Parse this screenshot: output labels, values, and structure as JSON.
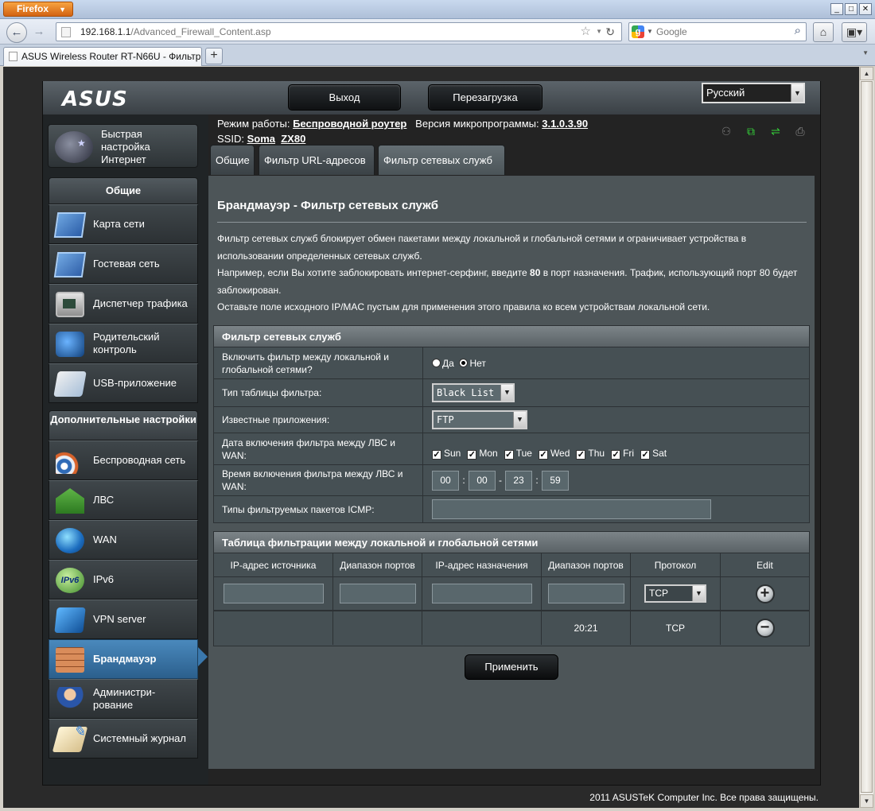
{
  "browser": {
    "app_button": "Firefox",
    "url_host": "192.168.1.1",
    "url_path": "/Advanced_Firewall_Content.asp",
    "search_placeholder": "Google",
    "tab_title": "ASUS Wireless Router RT-N66U - Фильтр се..."
  },
  "header": {
    "logo": "ASUS",
    "logout": "Выход",
    "reboot": "Перезагрузка",
    "language": "Русский"
  },
  "status": {
    "mode_label": "Режим работы:",
    "mode_value": "Беспроводной роутер",
    "fw_label": "Версия микропрограммы:",
    "fw_value": "3.1.0.3.90",
    "ssid_label": "SSID:",
    "ssid_1": "Soma",
    "ssid_2": "ZX80"
  },
  "sidebar": {
    "qis_label": "Быстрая настройка Интернет",
    "general_header": "Общие",
    "general_items": [
      {
        "label": "Карта сети",
        "icon": "network-map-icon"
      },
      {
        "label": "Гостевая сеть",
        "icon": "guest-network-icon"
      },
      {
        "label": "Диспетчер трафика",
        "icon": "traffic-manager-icon"
      },
      {
        "label": "Родительский контроль",
        "icon": "parental-control-icon"
      },
      {
        "label": "USB-приложение",
        "icon": "usb-application-icon"
      }
    ],
    "advanced_header": "Дополнительные настройки",
    "advanced_items": [
      {
        "label": "Беспроводная сеть",
        "icon": "wireless-icon"
      },
      {
        "label": "ЛВС",
        "icon": "lan-icon"
      },
      {
        "label": "WAN",
        "icon": "wan-icon"
      },
      {
        "label": "IPv6",
        "icon": "ipv6-icon"
      },
      {
        "label": "VPN server",
        "icon": "vpn-icon"
      },
      {
        "label": "Брандмауэр",
        "icon": "firewall-icon"
      },
      {
        "label": "Администри-рование",
        "icon": "administration-icon"
      },
      {
        "label": "Системный журнал",
        "icon": "system-log-icon"
      }
    ],
    "active_item": "Брандмауэр"
  },
  "tabs": [
    "Общие",
    "Фильтр URL-адресов",
    "Фильтр сетевых служб"
  ],
  "page": {
    "title": "Брандмауэр - Фильтр сетевых служб",
    "desc_1": "Фильтр сетевых служб блокирует обмен пакетами между локальной и глобальной сетями и ограничивает устройства в использовании определенных сетевых служб.",
    "desc_2a": "Например, если Вы хотите заблокировать интернет-серфинг, введите ",
    "desc_2b": "80",
    "desc_2c": " в порт назначения. Трафик, использующий порт 80 будет заблокирован.",
    "desc_3": "Оставьте поле исходного IP/MAC пустым для применения этого правила ко всем устройствам локальной сети."
  },
  "filter": {
    "header": "Фильтр сетевых служб",
    "enable_label": "Включить фильтр между локальной и глобальной сетями?",
    "yes": "Да",
    "no": "Нет",
    "enable_value": "Нет",
    "table_type_label": "Тип таблицы фильтра:",
    "table_type_value": "Black List",
    "known_apps_label": "Известные приложения:",
    "known_apps_value": "FTP",
    "days_label": "Дата включения фильтра между ЛВС и WAN:",
    "days": [
      "Sun",
      "Mon",
      "Tue",
      "Wed",
      "Thu",
      "Fri",
      "Sat"
    ],
    "time_label": "Время включения фильтра между ЛВС и WAN:",
    "time": [
      "00",
      "00",
      "23",
      "59"
    ],
    "icmp_label": "Типы фильтруемых пакетов ICMP:",
    "icmp_value": ""
  },
  "lw_table": {
    "header": "Таблица фильтрации между локальной и глобальной сетями",
    "columns": [
      "IP-адрес источника",
      "Диапазон портов",
      "IP-адрес назначения",
      "Диапазон портов",
      "Протокол",
      "Edit"
    ],
    "new_protocol": "TCP",
    "rows": [
      {
        "src_ip": "",
        "src_ports": "",
        "dst_ip": "",
        "dst_ports": "20:21",
        "protocol": "TCP"
      }
    ]
  },
  "apply": "Применить",
  "footer": "2011 ASUSTeK Computer Inc. Все права защищены."
}
